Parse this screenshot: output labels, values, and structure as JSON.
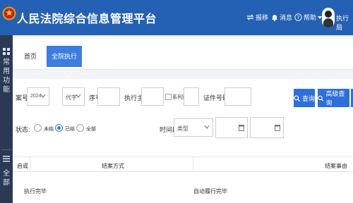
{
  "header": {
    "title": "人民法院综合信息管理平台",
    "items": {
      "transfer": "报移",
      "messages": "消息",
      "help": "帮助",
      "user": "执行局"
    },
    "colors": {
      "bar": "#2461b4",
      "accent": "#3b7de0"
    }
  },
  "sidebar": {
    "section1": "常用功能",
    "section2": "全部"
  },
  "tabs": {
    "home": "首页",
    "active": "全院执行···",
    "active_close": "X"
  },
  "filters": {
    "case_no_label": "案号:",
    "year_value": "2024",
    "code_label": "代字",
    "seq_label": "序号",
    "subject_label": "执行主体:",
    "series_label": "系列案",
    "cert_label": "证件号码:",
    "search_button": "查询",
    "advanced_button": "高级查询",
    "status_label": "状态:",
    "status_options": [
      "未结",
      "已结",
      "全部"
    ],
    "status_selected": "已结",
    "period_label": "时间段:",
    "type_value": "类型"
  },
  "table": {
    "headers": [
      "启或",
      "结案方式",
      "结案事由"
    ],
    "rows": [
      {
        "col1": "执行完毕",
        "col2": "自动履行完毕"
      }
    ]
  }
}
